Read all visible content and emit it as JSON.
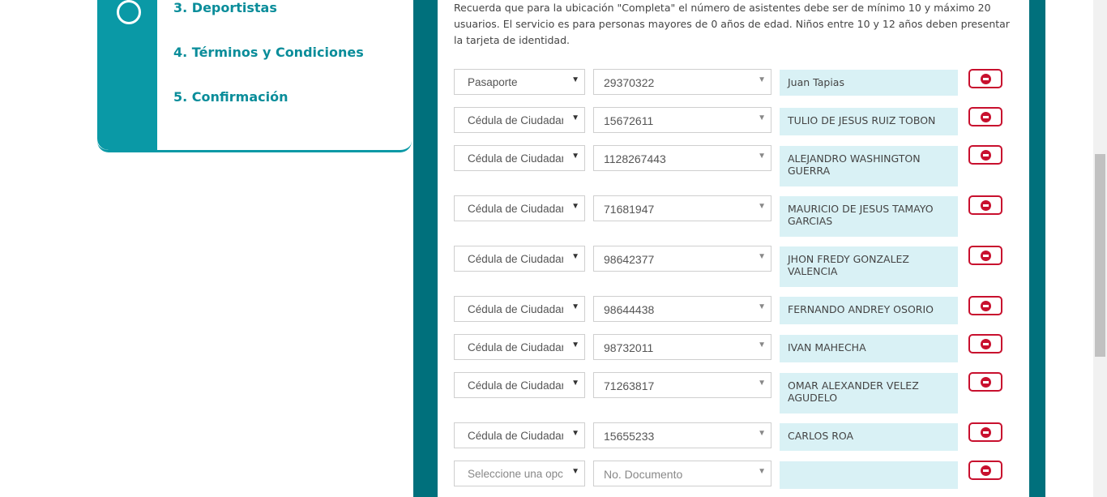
{
  "steps": [
    {
      "label": "3. Deportistas"
    },
    {
      "label": "4. Términos y Condiciones"
    },
    {
      "label": "5. Confirmación"
    }
  ],
  "notice": "Recuerda que para la ubicación \"Completa\" el número de asistentes debe ser de mínimo 10 y máximo 20 usuarios. El servicio es para personas mayores de 0 años de edad. Niños entre 10 y 12 años deben presentar la tarjeta de identidad.",
  "attendees": [
    {
      "doc_type": "Pasaporte",
      "doc_number": "29370322",
      "name": "Juan Tapias"
    },
    {
      "doc_type": "Cédula de Ciudadar",
      "doc_number": "15672611",
      "name": "TULIO DE JESUS RUIZ TOBON"
    },
    {
      "doc_type": "Cédula de Ciudadar",
      "doc_number": "1128267443",
      "name": "ALEJANDRO WASHINGTON GUERRA"
    },
    {
      "doc_type": "Cédula de Ciudadar",
      "doc_number": "71681947",
      "name": "MAURICIO DE JESUS TAMAYO GARCIAS"
    },
    {
      "doc_type": "Cédula de Ciudadar",
      "doc_number": "98642377",
      "name": "JHON FREDY GONZALEZ VALENCIA"
    },
    {
      "doc_type": "Cédula de Ciudadar",
      "doc_number": "98644438",
      "name": "FERNANDO ANDREY OSORIO"
    },
    {
      "doc_type": "Cédula de Ciudadar",
      "doc_number": "98732011",
      "name": "IVAN MAHECHA"
    },
    {
      "doc_type": "Cédula de Ciudadar",
      "doc_number": "71263817",
      "name": "OMAR ALEXANDER VELEZ AGUDELO"
    },
    {
      "doc_type": "Cédula de Ciudadar",
      "doc_number": "15655233",
      "name": "CARLOS ROA"
    },
    {
      "doc_type": "Seleccione una opci",
      "doc_number": "No. Documento",
      "name": "",
      "placeholder": true
    }
  ],
  "icons": {
    "step_marker": "step-circle-icon",
    "remove": "remove-circle-icon",
    "dropdown": "caret-down-icon"
  },
  "colors": {
    "teal": "#0a99a6",
    "dark_teal": "#00707c",
    "name_bg": "#d9f1f5",
    "remove_red": "#c8102e"
  }
}
